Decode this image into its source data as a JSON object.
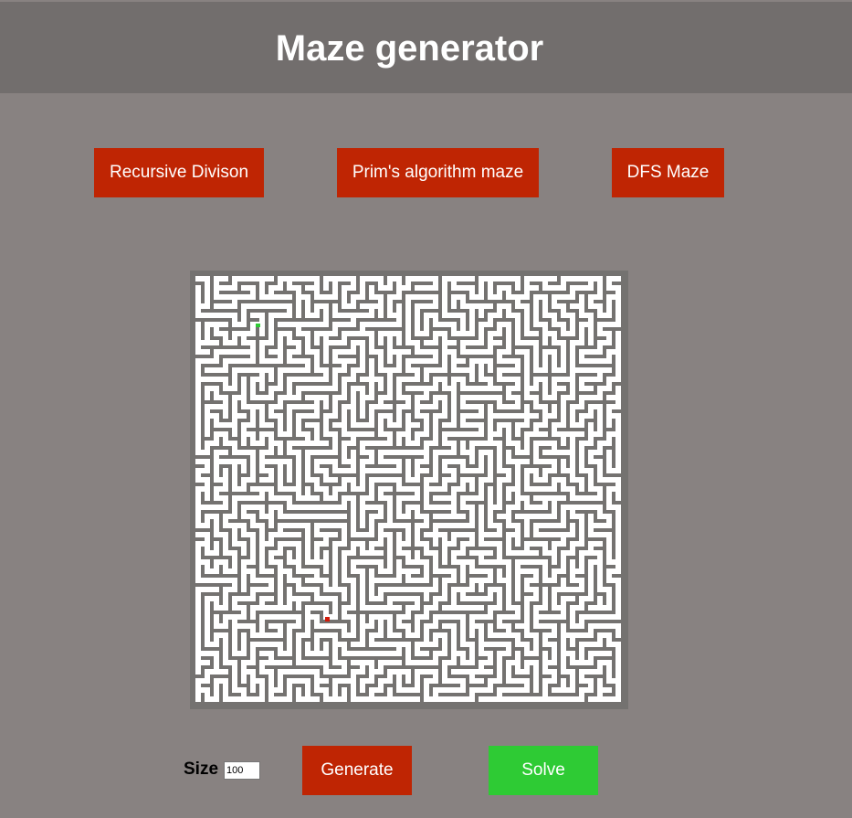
{
  "header": {
    "title": "Maze generator"
  },
  "algorithms": {
    "recursive_label": "Recursive Divison",
    "prim_label": "Prim's algorithm maze",
    "dfs_label": "DFS Maze"
  },
  "controls": {
    "size_label": "Size",
    "size_value": "100",
    "generate_label": "Generate",
    "solve_label": "Solve"
  },
  "maze": {
    "wall_color": "#747270",
    "path_color": "#ffffff",
    "start_color": "#2ecb34",
    "end_color": "#d11a0a"
  },
  "colors": {
    "background": "#888281",
    "header": "#726e6d",
    "button_red": "#bf2503",
    "button_green": "#2ecb34"
  }
}
